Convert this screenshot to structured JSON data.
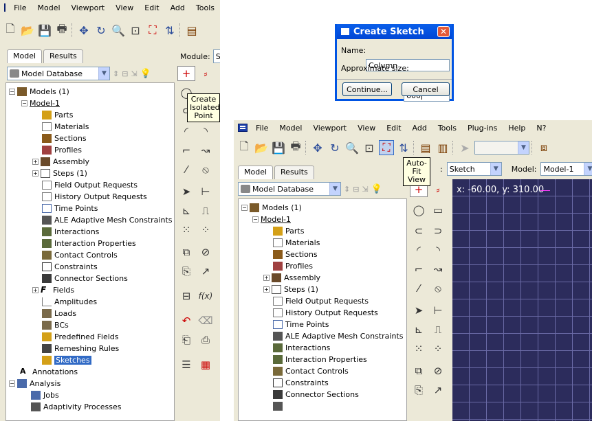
{
  "menu": {
    "items": [
      "File",
      "Model",
      "Viewport",
      "View",
      "Edit",
      "Add",
      "Tools"
    ],
    "items_full": [
      "File",
      "Model",
      "Viewport",
      "View",
      "Edit",
      "Add",
      "Tools",
      "Plug-ins",
      "Help",
      "N?"
    ]
  },
  "left_panel": {
    "module_label": "Module:",
    "module_value": "Sk",
    "tabs": [
      "Model",
      "Results"
    ],
    "db_label": "Model Database",
    "tree": {
      "models": "Models (1)",
      "model1": "Model-1",
      "parts": "Parts",
      "materials": "Materials",
      "sections": "Sections",
      "profiles": "Profiles",
      "assembly": "Assembly",
      "steps": "Steps (1)",
      "field_output": "Field Output Requests",
      "history_output": "History Output Requests",
      "time_points": "Time Points",
      "ale": "ALE Adaptive Mesh Constraints",
      "interactions": "Interactions",
      "interaction_props": "Interaction Properties",
      "contact_controls": "Contact Controls",
      "constraints": "Constraints",
      "connector_sections": "Connector Sections",
      "fields": "Fields",
      "amplitudes": "Amplitudes",
      "loads": "Loads",
      "bcs": "BCs",
      "predefined": "Predefined Fields",
      "remeshing": "Remeshing Rules",
      "sketches": "Sketches",
      "annotations": "Annotations",
      "analysis": "Analysis",
      "jobs": "Jobs",
      "adaptivity": "Adaptivity Processes"
    },
    "tooltip": "Create\nIsolated\nPoint"
  },
  "dialog": {
    "title": "Create Sketch",
    "name_label": "Name:",
    "name_value": "Column",
    "size_label": "Approximate size:",
    "size_value": "600",
    "continue": "Continue...",
    "cancel": "Cancel"
  },
  "right_panel": {
    "module_value": "Sketch",
    "model_label": "Model:",
    "model_value": "Model-1",
    "tooltip": "Auto-Fit\nView",
    "coords": "x: -60.00, y: 310.00",
    "tabs": [
      "Model",
      "Results"
    ],
    "db_label": "Model Database"
  },
  "colors": {
    "canvas": "#2c2c5c",
    "grid": "#6a6aa6",
    "selection": "#316ac5",
    "title": "#0a5fea"
  }
}
